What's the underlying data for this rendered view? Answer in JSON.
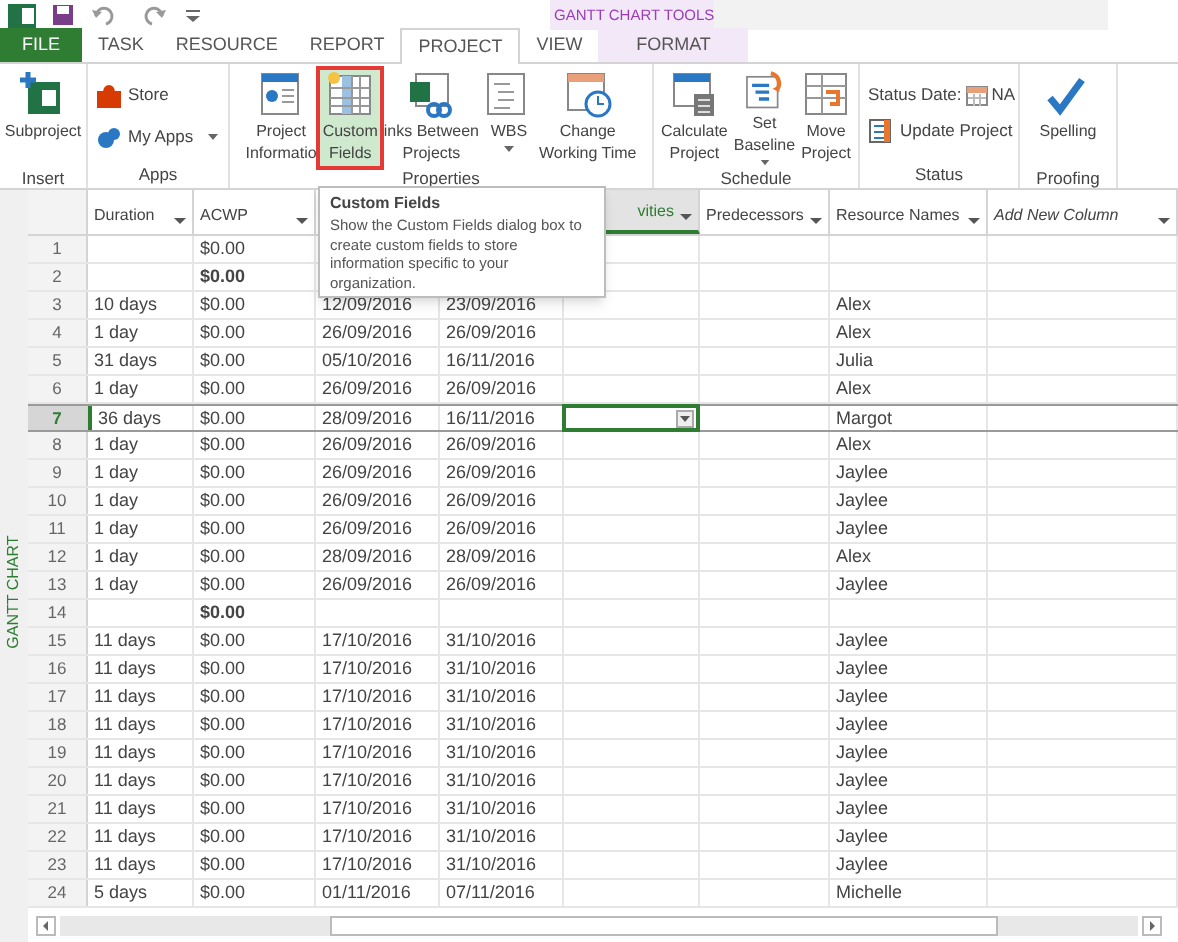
{
  "contextual_tab_group": "GANTT CHART TOOLS",
  "tabs": [
    {
      "label": "FILE",
      "kind": "file",
      "selected": false
    },
    {
      "label": "TASK",
      "kind": "normal",
      "selected": false
    },
    {
      "label": "RESOURCE",
      "kind": "normal",
      "selected": false
    },
    {
      "label": "REPORT",
      "kind": "normal",
      "selected": false
    },
    {
      "label": "PROJECT",
      "kind": "normal",
      "selected": true
    },
    {
      "label": "VIEW",
      "kind": "normal",
      "selected": false
    },
    {
      "label": "FORMAT",
      "kind": "contextual",
      "selected": false
    }
  ],
  "ribbon_groups": [
    {
      "label": "Insert",
      "commands": [
        {
          "kind": "large",
          "lines": [
            "Subproject"
          ],
          "selected": false,
          "dropdown": false
        }
      ]
    },
    {
      "label": "Apps",
      "commands": [
        {
          "kind": "small",
          "lines": [
            "Store"
          ],
          "selected": false,
          "dropdown": false
        },
        {
          "kind": "small",
          "lines": [
            "My Apps"
          ],
          "selected": false,
          "dropdown": true
        }
      ]
    },
    {
      "label": "Properties",
      "commands": [
        {
          "kind": "large",
          "lines": [
            "Project",
            "Informatio"
          ],
          "selected": false,
          "dropdown": false
        },
        {
          "kind": "large",
          "lines": [
            "Custom",
            "Fields"
          ],
          "selected": true,
          "dropdown": false
        },
        {
          "kind": "large",
          "lines": [
            "inks Between",
            "Projects"
          ],
          "selected": false,
          "dropdown": false
        },
        {
          "kind": "large",
          "lines": [
            "WBS"
          ],
          "selected": false,
          "dropdown": true
        },
        {
          "kind": "large",
          "lines": [
            "Change",
            "Working Time"
          ],
          "selected": false,
          "dropdown": false
        }
      ]
    },
    {
      "label": "Schedule",
      "commands": [
        {
          "kind": "large",
          "lines": [
            "Calculate",
            "Project"
          ],
          "selected": false,
          "dropdown": false
        },
        {
          "kind": "large",
          "lines": [
            "Set",
            "Baseline"
          ],
          "selected": false,
          "dropdown": true
        },
        {
          "kind": "large",
          "lines": [
            "Move",
            "Project"
          ],
          "selected": false,
          "dropdown": false
        }
      ]
    },
    {
      "label": "Status",
      "commands": [
        {
          "kind": "status_date",
          "lines": [
            "Status Date:"
          ],
          "value": "NA",
          "selected": false,
          "dropdown": false
        },
        {
          "kind": "small",
          "lines": [
            "Update Project"
          ],
          "selected": false,
          "dropdown": false
        }
      ]
    },
    {
      "label": "Proofing",
      "commands": [
        {
          "kind": "large",
          "lines": [
            "Spelling"
          ],
          "selected": false,
          "dropdown": false
        }
      ]
    }
  ],
  "tooltip": {
    "title": "Custom Fields",
    "body": "Show the Custom Fields dialog box to create custom fields to store information specific to your organization."
  },
  "side_label": "GANTT CHART",
  "table": {
    "columns": [
      {
        "label": "Duration",
        "kind": "field",
        "selected": false
      },
      {
        "label": "ACWP",
        "kind": "field",
        "selected": false
      },
      {
        "kind": "hidden"
      },
      {
        "kind": "hidden"
      },
      {
        "label": "vities",
        "kind": "field",
        "selected": true
      },
      {
        "label": "Predecessors",
        "kind": "field",
        "selected": false
      },
      {
        "label": "Resource Names",
        "kind": "field",
        "selected": false
      },
      {
        "label": "Add New Column",
        "kind": "add",
        "selected": false
      }
    ],
    "rows": [
      {
        "id": "1",
        "acwp": "$0.00",
        "summary": false,
        "selected": false
      },
      {
        "id": "2",
        "acwp": "$0.00",
        "summary": true,
        "selected": false
      },
      {
        "id": "3",
        "duration": "10 days",
        "acwp": "$0.00",
        "start": "12/09/2016",
        "finish": "23/09/2016",
        "resource": "Alex",
        "summary": false,
        "selected": false
      },
      {
        "id": "4",
        "duration": "1 day",
        "acwp": "$0.00",
        "start": "26/09/2016",
        "finish": "26/09/2016",
        "resource": "Alex",
        "summary": false,
        "selected": false
      },
      {
        "id": "5",
        "duration": "31 days",
        "acwp": "$0.00",
        "start": "05/10/2016",
        "finish": "16/11/2016",
        "resource": "Julia",
        "summary": false,
        "selected": false
      },
      {
        "id": "6",
        "duration": "1 day",
        "acwp": "$0.00",
        "start": "26/09/2016",
        "finish": "26/09/2016",
        "resource": "Alex",
        "summary": false,
        "selected": false
      },
      {
        "id": "7",
        "duration": "36 days",
        "acwp": "$0.00",
        "start": "28/09/2016",
        "finish": "16/11/2016",
        "resource": "Margot",
        "summary": false,
        "selected": true
      },
      {
        "id": "8",
        "duration": "1 day",
        "acwp": "$0.00",
        "start": "26/09/2016",
        "finish": "26/09/2016",
        "resource": "Alex",
        "summary": false,
        "selected": false
      },
      {
        "id": "9",
        "duration": "1 day",
        "acwp": "$0.00",
        "start": "26/09/2016",
        "finish": "26/09/2016",
        "resource": "Jaylee",
        "summary": false,
        "selected": false
      },
      {
        "id": "10",
        "duration": "1 day",
        "acwp": "$0.00",
        "start": "26/09/2016",
        "finish": "26/09/2016",
        "resource": "Jaylee",
        "summary": false,
        "selected": false
      },
      {
        "id": "11",
        "duration": "1 day",
        "acwp": "$0.00",
        "start": "26/09/2016",
        "finish": "26/09/2016",
        "resource": "Jaylee",
        "summary": false,
        "selected": false
      },
      {
        "id": "12",
        "duration": "1 day",
        "acwp": "$0.00",
        "start": "28/09/2016",
        "finish": "28/09/2016",
        "resource": "Alex",
        "summary": false,
        "selected": false
      },
      {
        "id": "13",
        "duration": "1 day",
        "acwp": "$0.00",
        "start": "26/09/2016",
        "finish": "26/09/2016",
        "resource": "Jaylee",
        "summary": false,
        "selected": false
      },
      {
        "id": "14",
        "acwp": "$0.00",
        "summary": true,
        "selected": false
      },
      {
        "id": "15",
        "duration": "11 days",
        "acwp": "$0.00",
        "start": "17/10/2016",
        "finish": "31/10/2016",
        "resource": "Jaylee",
        "summary": false,
        "selected": false
      },
      {
        "id": "16",
        "duration": "11 days",
        "acwp": "$0.00",
        "start": "17/10/2016",
        "finish": "31/10/2016",
        "resource": "Jaylee",
        "summary": false,
        "selected": false
      },
      {
        "id": "17",
        "duration": "11 days",
        "acwp": "$0.00",
        "start": "17/10/2016",
        "finish": "31/10/2016",
        "resource": "Jaylee",
        "summary": false,
        "selected": false
      },
      {
        "id": "18",
        "duration": "11 days",
        "acwp": "$0.00",
        "start": "17/10/2016",
        "finish": "31/10/2016",
        "resource": "Jaylee",
        "summary": false,
        "selected": false
      },
      {
        "id": "19",
        "duration": "11 days",
        "acwp": "$0.00",
        "start": "17/10/2016",
        "finish": "31/10/2016",
        "resource": "Jaylee",
        "summary": false,
        "selected": false
      },
      {
        "id": "20",
        "duration": "11 days",
        "acwp": "$0.00",
        "start": "17/10/2016",
        "finish": "31/10/2016",
        "resource": "Jaylee",
        "summary": false,
        "selected": false
      },
      {
        "id": "21",
        "duration": "11 days",
        "acwp": "$0.00",
        "start": "17/10/2016",
        "finish": "31/10/2016",
        "resource": "Jaylee",
        "summary": false,
        "selected": false
      },
      {
        "id": "22",
        "duration": "11 days",
        "acwp": "$0.00",
        "start": "17/10/2016",
        "finish": "31/10/2016",
        "resource": "Jaylee",
        "summary": false,
        "selected": false
      },
      {
        "id": "23",
        "duration": "11 days",
        "acwp": "$0.00",
        "start": "17/10/2016",
        "finish": "31/10/2016",
        "resource": "Jaylee",
        "summary": false,
        "selected": false
      },
      {
        "id": "24",
        "duration": "5 days",
        "acwp": "$0.00",
        "start": "01/11/2016",
        "finish": "07/11/2016",
        "resource": "Michelle",
        "summary": false,
        "selected": false
      }
    ]
  }
}
